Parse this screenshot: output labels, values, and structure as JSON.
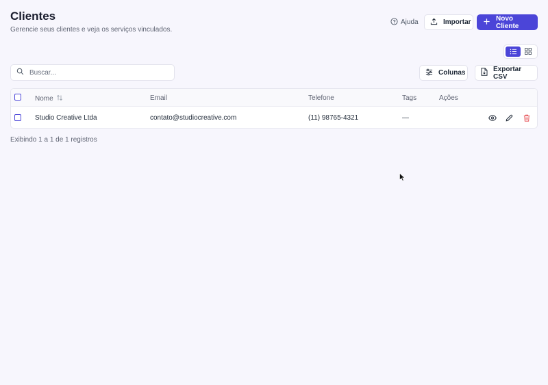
{
  "header": {
    "title": "Clientes",
    "subtitle": "Gerencie seus clientes e veja os serviços vinculados.",
    "help_label": "Ajuda",
    "import_label": "Importar",
    "new_client_label": "Novo Cliente"
  },
  "toolbar": {
    "search_placeholder": "Buscar...",
    "columns_label": "Colunas",
    "export_label": "Exportar CSV",
    "view_mode": "list"
  },
  "table": {
    "columns": [
      "Nome",
      "Email",
      "Telefone",
      "Tags",
      "Ações"
    ],
    "rows": [
      {
        "name": "Studio Creative Ltda",
        "email": "contato@studiocreative.com",
        "phone": "(11) 98765-4321",
        "tags": "—"
      }
    ]
  },
  "footer": {
    "summary": "Exibindo 1 a 1 de 1 registros"
  },
  "colors": {
    "accent": "#4b45d8",
    "background": "#f7f6fd",
    "danger": "#e5484d"
  }
}
